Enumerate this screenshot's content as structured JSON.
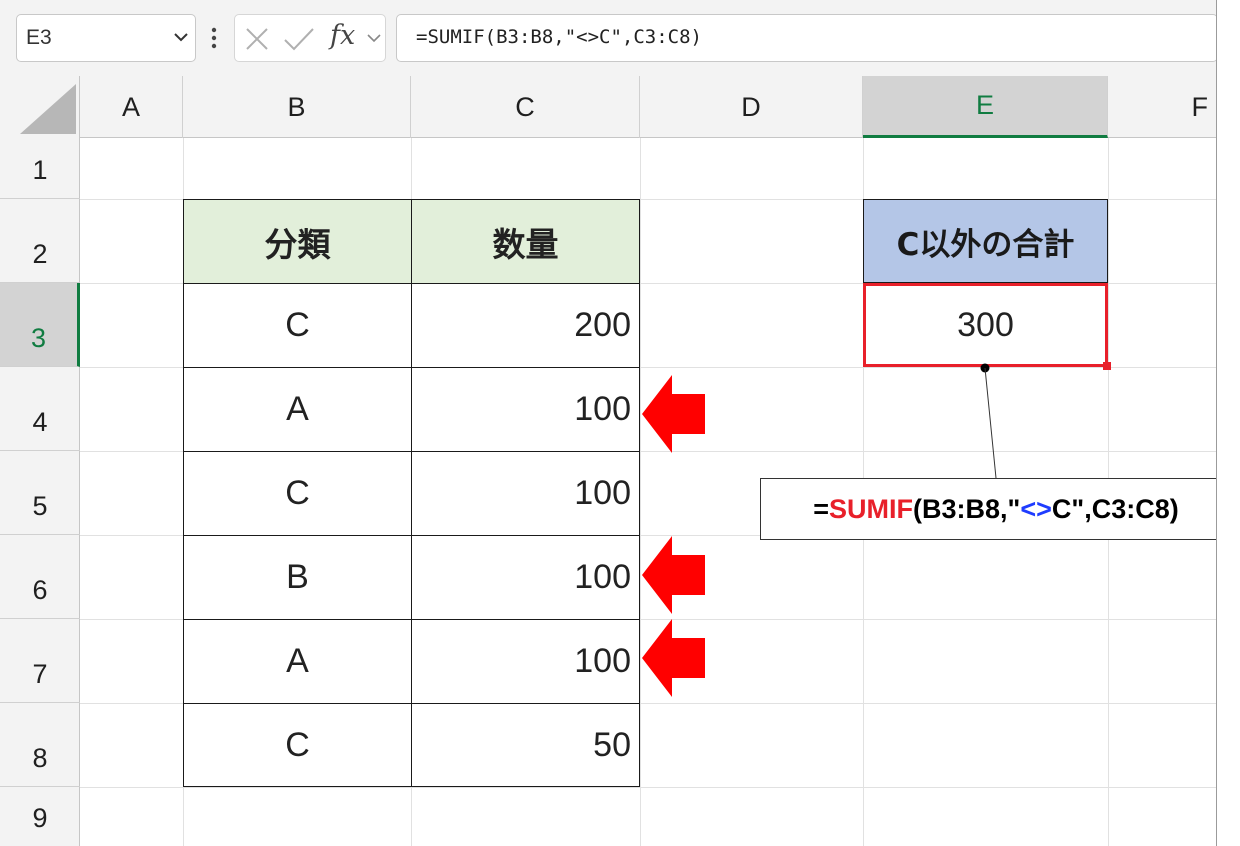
{
  "formula_bar": {
    "name_box": "E3",
    "fx_label": "fx",
    "formula": "=SUMIF(B3:B8,\"<>C\",C3:C8)"
  },
  "columns": [
    "A",
    "B",
    "C",
    "D",
    "E",
    "F"
  ],
  "rows": [
    "1",
    "2",
    "3",
    "4",
    "5",
    "6",
    "7",
    "8",
    "9"
  ],
  "selected": {
    "column": "E",
    "row": "3"
  },
  "table": {
    "headers": [
      "分類",
      "数量"
    ],
    "rows": [
      {
        "category": "C",
        "quantity": "200"
      },
      {
        "category": "A",
        "quantity": "100"
      },
      {
        "category": "C",
        "quantity": "100"
      },
      {
        "category": "B",
        "quantity": "100"
      },
      {
        "category": "A",
        "quantity": "100"
      },
      {
        "category": "C",
        "quantity": "50"
      }
    ]
  },
  "result": {
    "header": "C以外の合計",
    "value": "300"
  },
  "callout": {
    "prefix": "=",
    "func": "SUMIF",
    "args_start": "(B3:B8,\"",
    "operator": "<>",
    "args_end": "C\",C3:C8)"
  },
  "colors": {
    "accent_green": "#107c41",
    "header_green": "#e2efda",
    "header_blue": "#b4c6e7",
    "highlight_red": "#e8202a",
    "operator_blue": "#1f3cff"
  }
}
